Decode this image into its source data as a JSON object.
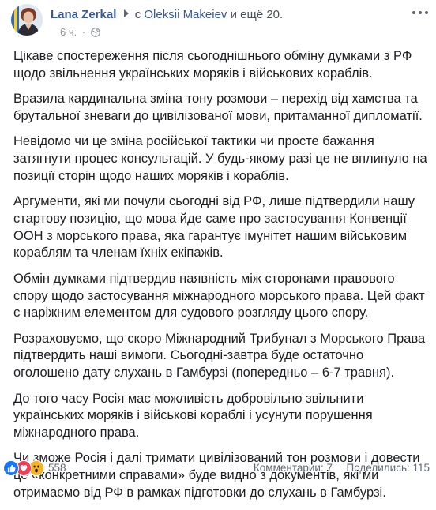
{
  "header": {
    "author_name": "Lana Zerkal",
    "with_prefix": "с",
    "tagged_person": "Oleksii Makeiev",
    "tagged_more": "и ещё 20.",
    "time": "6 ч.",
    "dot": "·",
    "privacy_icon": "globe-icon",
    "more_icon": "more-dots-icon"
  },
  "post": {
    "paragraphs": [
      "Цікаве спостереження після сьогоднішнього обміну думками з РФ щодо звільнення українських моряків і військових кораблів.",
      "Вразила кардинальна зміна тону розмови – перехід від хамства та брутальної зневаги до цивілізованої мови, притаманної дипломатії.",
      "Невідомо чи це зміна російської тактики чи просте бажання затягнути процес консультацій. У будь-якому разі це не вплинуло на позиції сторін щодо наших моряків і кораблів.",
      "Аргументи, які ми почули сьогодні від РФ, лише підтвердили нашу стартову позицію, що мова йде саме про застосування Конвенції ООН з морського права, яка гарантує імунітет нашим військовим кораблям та членам їхніх екіпажів.",
      "Обмін думками підтвердив наявність між сторонами правового спору щодо застосування міжнародного морського права. Цей факт є наріжним елементом для судового розгляду цього спору.",
      "Розраховуємо, що скоро Міжнародний Трибунал з Морського Права підтвердить наші вимоги. Сьогодні-завтра буде остаточно оголошено дату слухань в Гамбурзі (попередньо – 6-7 травня).",
      "До того часу Росія має можливість добровільно звільнити українських моряків і військові кораблі і усунути порушення міжнародного права.",
      "Чи зможе Росія і далі тримати цивілізований тон розмови і довести це «конкретними справами» буде видно з документів, які ми отримаємо від РФ в рамках підготовки до слухань в Гамбурзі."
    ]
  },
  "footer": {
    "reaction_icons": [
      "like-icon",
      "love-icon",
      "wow-icon"
    ],
    "reaction_count": "558",
    "comments": "Комментарии: 7",
    "shares": "Поделились: 115"
  },
  "colors": {
    "link_blue": "#385898",
    "like_blue": "#1877f2",
    "love_red": "#f33e58",
    "wow_yellow": "#f7b125",
    "meta_gray": "#90949c"
  }
}
